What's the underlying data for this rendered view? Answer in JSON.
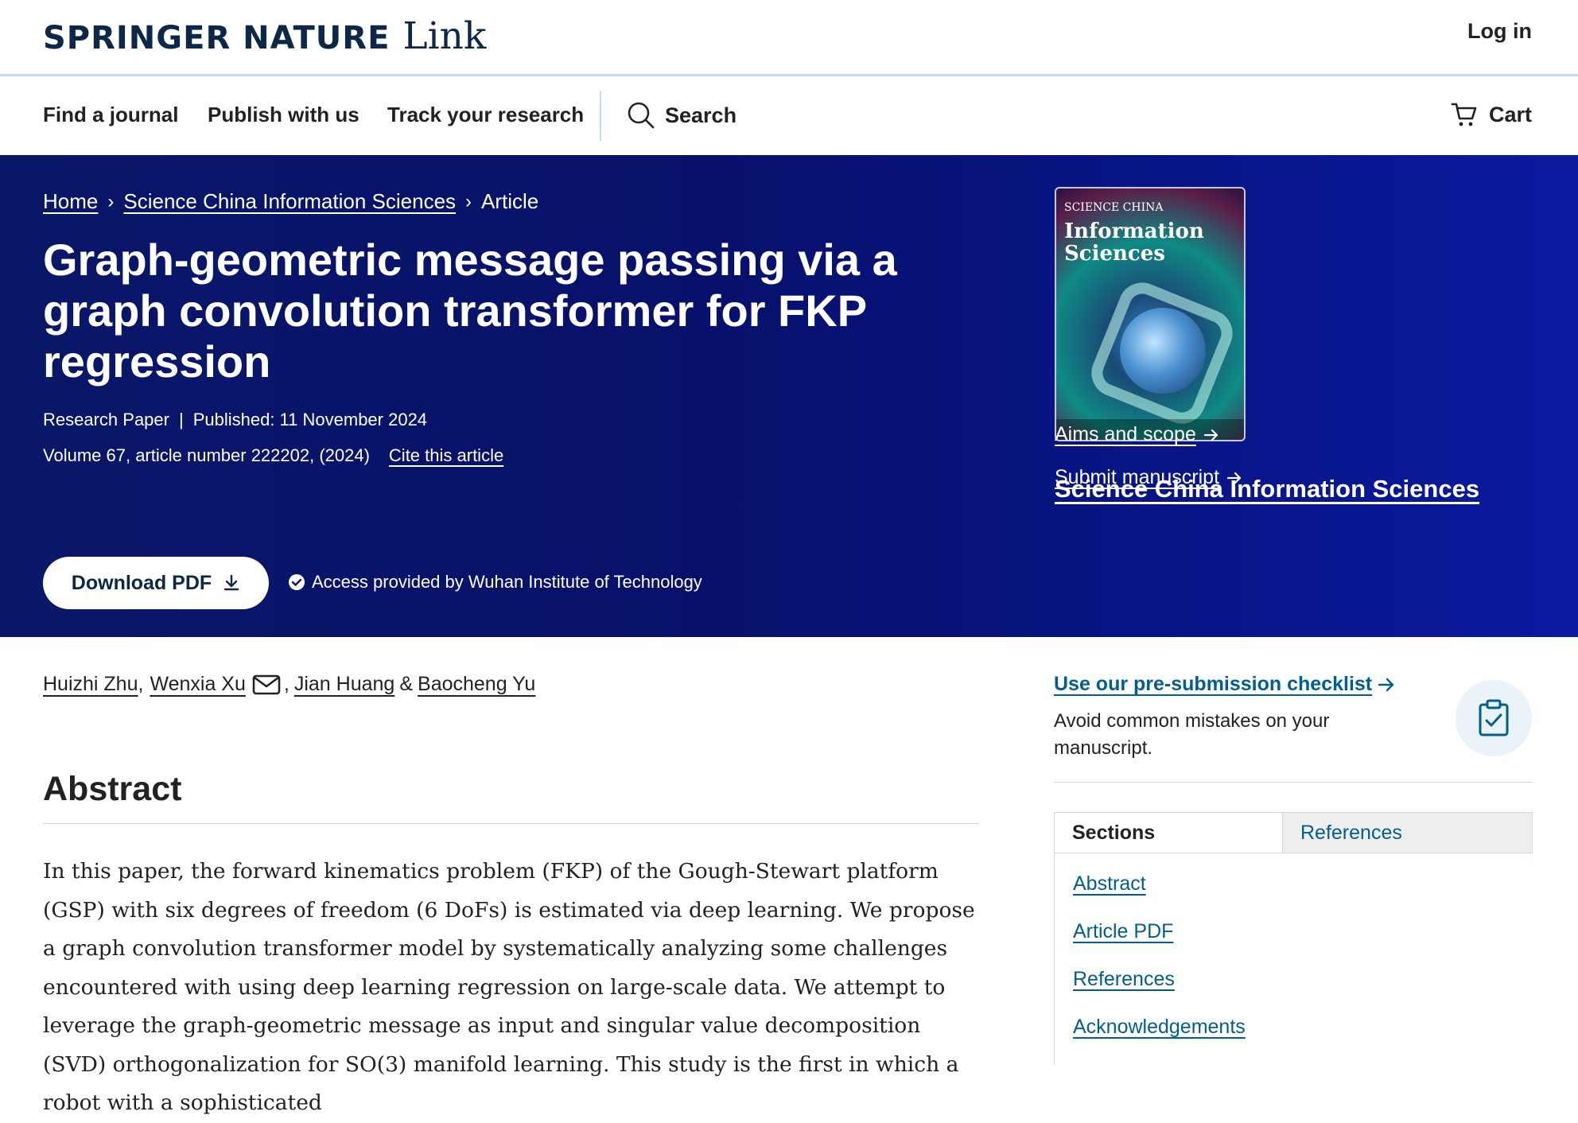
{
  "header": {
    "logo_brand": "SPRINGER NATURE",
    "logo_link": "Link",
    "login": "Log in"
  },
  "nav": {
    "items": [
      "Find a journal",
      "Publish with us",
      "Track your research"
    ],
    "search": "Search",
    "cart": "Cart"
  },
  "breadcrumb": {
    "home": "Home",
    "journal": "Science China Information Sciences",
    "current": "Article"
  },
  "article": {
    "title": "Graph-geometric message passing via a graph convolution transformer for FKP regression",
    "type": "Research Paper",
    "published": "Published: 11 November 2024",
    "volume": "Volume 67, article number 222202, (2024)",
    "cite": "Cite this article"
  },
  "actions": {
    "download": "Download PDF",
    "access": "Access provided by Wuhan Institute of Technology"
  },
  "journal_panel": {
    "name": "Science China Information Sciences",
    "aims": "Aims and scope",
    "submit": "Submit manuscript",
    "cover_top": "SCIENCE CHINA",
    "cover_title_1": "Information",
    "cover_title_2": "Sciences"
  },
  "authors": [
    {
      "name": "Huizhi Zhu",
      "sep": ","
    },
    {
      "name": "Wenxia Xu",
      "sep": ","
    },
    {
      "name": "Jian Huang",
      "sep": "&"
    },
    {
      "name": "Baocheng Yu",
      "sep": ""
    }
  ],
  "abstract": {
    "heading": "Abstract",
    "text": "In this paper, the forward kinematics problem (FKP) of the Gough-Stewart platform (GSP) with six degrees of freedom (6 DoFs) is estimated via deep learning. We propose a graph convolution transformer model by systematically analyzing some challenges encountered with using deep learning regression on large-scale data. We attempt to leverage the graph-geometric message as input and singular value decomposition (SVD) orthogonalization for SO(3) manifold learning. This study is the first in which a robot with a sophisticated"
  },
  "sidebar": {
    "checklist_link": "Use our pre-submission checklist",
    "checklist_desc": "Avoid common mistakes on your manuscript.",
    "tabs": [
      "Sections",
      "References"
    ],
    "sections": [
      "Abstract",
      "Article PDF",
      "References",
      "Acknowledgements"
    ]
  },
  "colors": {
    "brand_navy": "#0c2748",
    "hero_blue": "#07116b",
    "link_blue": "#025e8d"
  }
}
